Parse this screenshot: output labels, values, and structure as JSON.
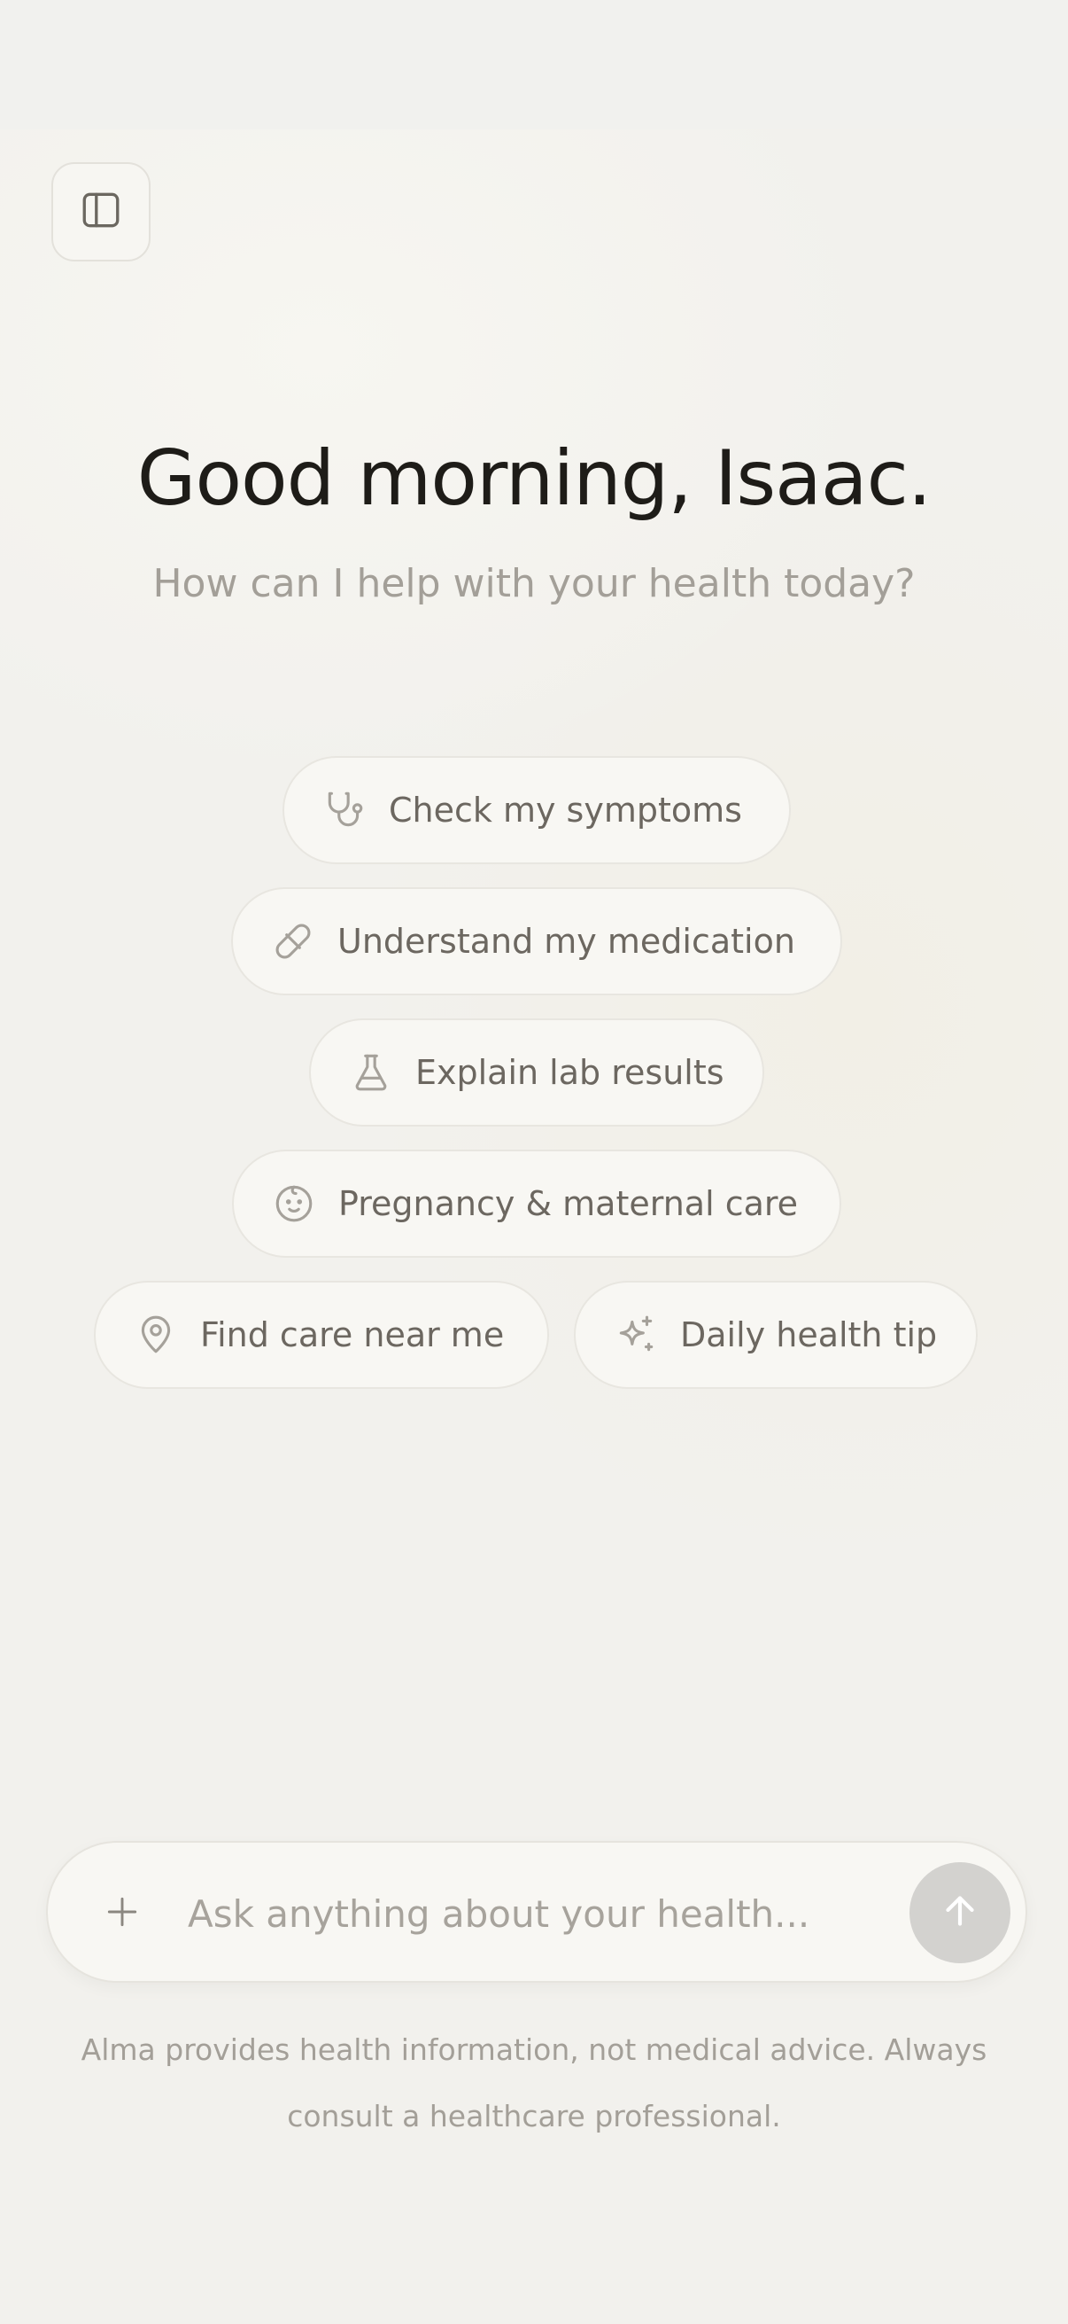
{
  "header": {
    "sidebar_icon": "sidebar-panel-icon"
  },
  "hero": {
    "greeting": "Good morning, Isaac.",
    "subtitle": "How can I help with your health today?"
  },
  "suggestions": [
    {
      "label": "Check my symptoms",
      "icon": "stethoscope-icon"
    },
    {
      "label": "Understand my medication",
      "icon": "pill-icon"
    },
    {
      "label": "Explain lab results",
      "icon": "flask-icon"
    },
    {
      "label": "Pregnancy & maternal care",
      "icon": "baby-face-icon"
    },
    {
      "label": "Find care near me",
      "icon": "map-pin-icon"
    },
    {
      "label": "Daily health tip",
      "icon": "sparkles-icon"
    }
  ],
  "composer": {
    "placeholder": "Ask anything about your health...",
    "attach_icon": "plus-icon",
    "send_icon": "arrow-up-icon"
  },
  "disclaimer": "Alma provides health information, not medical advice. Always consult a healthcare professional.",
  "colors": {
    "background": "#f2f1ed",
    "chip_background": "#f8f7f3",
    "chip_text": "#6c6760",
    "icon_stroke": "#a5a19a",
    "heading_text": "#1e1c18",
    "muted_text": "#a39f98",
    "send_button_disabled": "#d3d2cf"
  }
}
